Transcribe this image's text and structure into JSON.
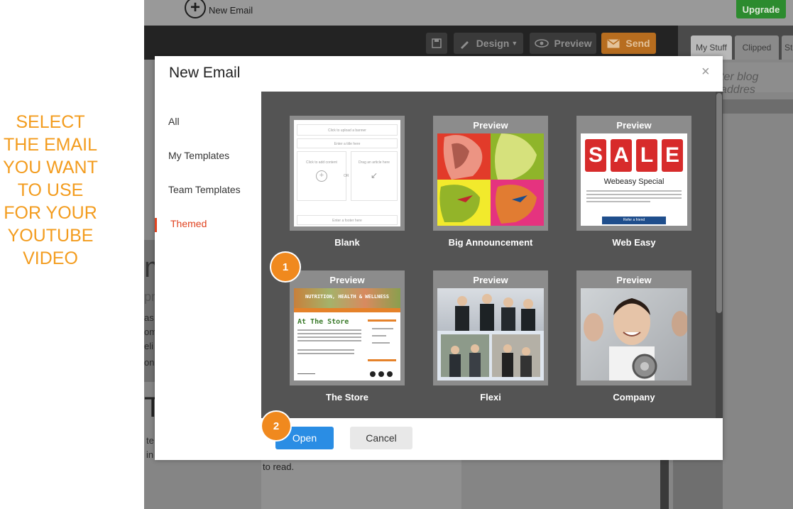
{
  "annotation": {
    "lines": [
      "SELECT",
      "THE EMAIL",
      "YOU WANT",
      "TO USE",
      "FOR YOUR",
      "YOUTUBE",
      "VIDEO"
    ],
    "color": "#f39c1e"
  },
  "app": {
    "new_email_label": "New Email",
    "upgrade_label": "Upgrade",
    "toolbar": {
      "design_label": "Design",
      "preview_label": "Preview",
      "send_label": "Send"
    },
    "tabs": [
      "My Stuff",
      "Clipped",
      "Sto"
    ],
    "blog_placeholder": "ter blog addres",
    "behind_text": "to read.",
    "behind_fragments": [
      "as",
      "om",
      "eli",
      "on",
      "te",
      "in"
    ],
    "behind_big_letters": [
      "m",
      "Ti"
    ],
    "behind_fragment_pr": "pr"
  },
  "modal": {
    "title": "New Email",
    "close_glyph": "×",
    "sidebar": [
      {
        "label": "All",
        "active": false
      },
      {
        "label": "My Templates",
        "active": false
      },
      {
        "label": "Team Templates",
        "active": false
      },
      {
        "label": "Themed",
        "active": true
      }
    ],
    "preview_label": "Preview",
    "templates": [
      {
        "name": "Blank"
      },
      {
        "name": "Big Announcement"
      },
      {
        "name": "Web Easy"
      },
      {
        "name": "The Store"
      },
      {
        "name": "Flexi"
      },
      {
        "name": "Company"
      }
    ],
    "blank_thumb": {
      "banner": "Click to upload a banner",
      "title": "Enter a title here",
      "add_content": "Click to add content",
      "or": "OR",
      "drag_article": "Drag an article here",
      "footer": "Enter a footer here"
    },
    "web_easy_thumb": {
      "sale_letters": [
        "S",
        "A",
        "L",
        "E"
      ],
      "heading": "Webeasy Special",
      "button": "Refer a friend"
    },
    "store_thumb": {
      "banner": "NUTRITION, HEALTH & WELLNESS",
      "heading": "At The Store"
    },
    "open_label": "Open",
    "cancel_label": "Cancel",
    "accent": "#2a8de4",
    "active_color": "#e0421f"
  },
  "badges": {
    "step1": "1",
    "step2": "2",
    "color": "#f0891e"
  }
}
